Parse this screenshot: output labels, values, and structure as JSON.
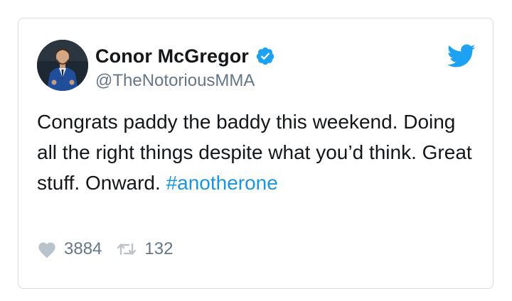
{
  "tweet": {
    "author_name": "Conor McGregor",
    "handle": "@TheNotoriousMMA",
    "text_parts": [
      "Congrats paddy the baddy this weekend. Doing all the right things despite what you’d think. Great stuff. Onward. ",
      "#anotherone"
    ],
    "likes": "3884",
    "retweets": "132",
    "icons": {
      "verified": "verified-badge-icon",
      "brand": "twitter-bird-icon",
      "like": "heart-icon",
      "retweet": "retweet-icon"
    },
    "colors": {
      "brand_blue": "#1da1f2",
      "hashtag_blue": "#1b95e0",
      "text": "#14171a",
      "muted": "#657786",
      "border": "#d9dee3"
    }
  }
}
